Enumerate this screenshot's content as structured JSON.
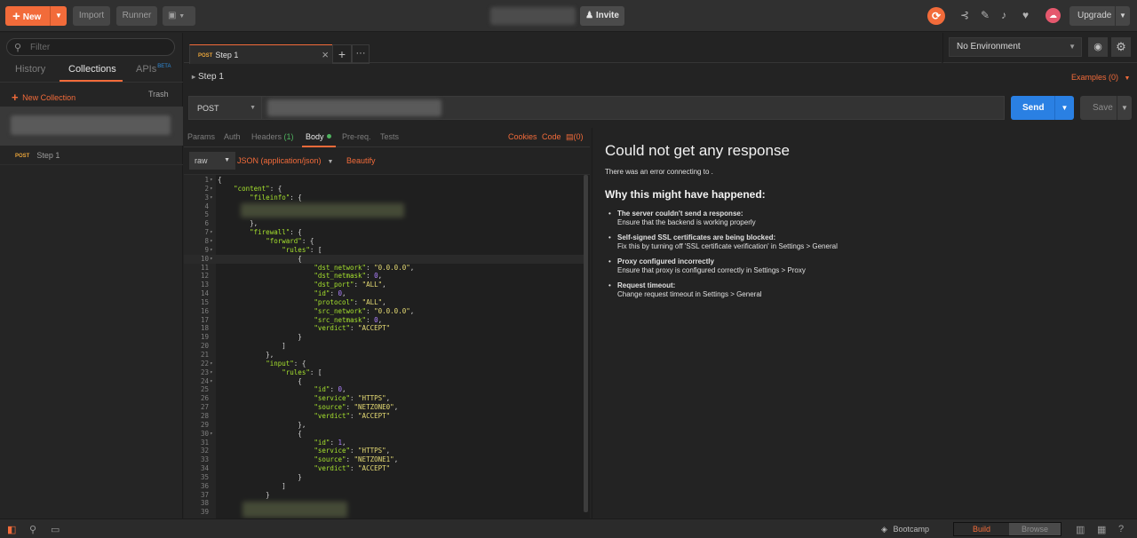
{
  "app": {
    "new_label": "New",
    "import_label": "Import",
    "runner_label": "Runner",
    "invite_label": "Invite",
    "upgrade_label": "Upgrade"
  },
  "sidebar": {
    "filter_placeholder": "Filter",
    "tabs": [
      {
        "label": "History"
      },
      {
        "label": "Collections"
      },
      {
        "label": "APIs"
      }
    ],
    "beta": "BETA",
    "new_collection": "New Collection",
    "trash": "Trash",
    "items": [
      {
        "method": "POST",
        "name": "Step 1"
      }
    ]
  },
  "tab": {
    "method": "POST",
    "name": "Step 1"
  },
  "environment": {
    "selected": "No Environment"
  },
  "request": {
    "name": "Step 1",
    "examples": "Examples (0)",
    "method": "POST",
    "send": "Send",
    "save": "Save",
    "tabs": [
      {
        "label": "Params"
      },
      {
        "label": "Auth"
      },
      {
        "label": "Headers",
        "count": "(1)"
      },
      {
        "label": "Body"
      },
      {
        "label": "Pre-req."
      },
      {
        "label": "Tests"
      }
    ],
    "links": {
      "cookies": "Cookies",
      "code": "Code",
      "comments": "(0)"
    },
    "body_mode": "raw",
    "body_type": "JSON (application/json)",
    "beautify": "Beautify"
  },
  "code_lines": [
    "{",
    "    \"content\": {",
    "        \"fileinfo\": {",
    "",
    "",
    "        },",
    "        \"firewall\": {",
    "            \"forward\": {",
    "                \"rules\": [",
    "                    {",
    "                        \"dst_network\": \"0.0.0.0\",",
    "                        \"dst_netmask\": 0,",
    "                        \"dst_port\": \"ALL\",",
    "                        \"id\": 0,",
    "                        \"protocol\": \"ALL\",",
    "                        \"src_network\": \"0.0.0.0\",",
    "                        \"src_netmask\": 0,",
    "                        \"verdict\": \"ACCEPT\"",
    "                    }",
    "                ]",
    "            },",
    "            \"input\": {",
    "                \"rules\": [",
    "                    {",
    "                        \"id\": 0,",
    "                        \"service\": \"HTTPS\",",
    "                        \"source\": \"NETZONE0\",",
    "                        \"verdict\": \"ACCEPT\"",
    "                    },",
    "                    {",
    "                        \"id\": 1,",
    "                        \"service\": \"HTTPS\",",
    "                        \"source\": \"NETZONE1\",",
    "                        \"verdict\": \"ACCEPT\"",
    "                    }",
    "                ]",
    "            }",
    "",
    ""
  ],
  "response": {
    "title": "Could not get any response",
    "subtitle": "There was an error connecting to .",
    "why": "Why this might have happened:",
    "reasons": [
      {
        "head": "The server couldn't send a response:",
        "desc": "Ensure that the backend is working properly"
      },
      {
        "head": "Self-signed SSL certificates are being blocked:",
        "desc": "Fix this by turning off 'SSL certificate verification' in Settings > General"
      },
      {
        "head": "Proxy configured incorrectly",
        "desc": "Ensure that proxy is configured correctly in Settings > Proxy"
      },
      {
        "head": "Request timeout:",
        "desc": "Change request timeout in Settings > General"
      }
    ]
  },
  "statusbar": {
    "bootcamp": "Bootcamp",
    "build": "Build",
    "browse": "Browse"
  }
}
